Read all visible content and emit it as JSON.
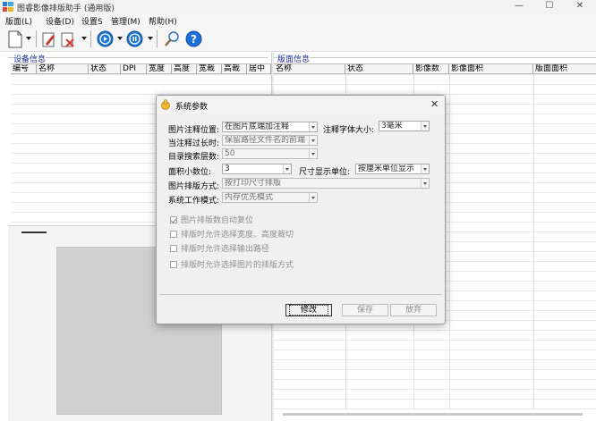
{
  "window": {
    "title": "图睿影像排版助手 (通用版)",
    "controls": {
      "minimize": "—",
      "maximize": "☐",
      "close": "✕"
    }
  },
  "menu": [
    "版面(L)",
    "设备(D)",
    "设置S",
    "管理(M)",
    "帮助(H)"
  ],
  "toolbar": {
    "icons": [
      "new-document-icon",
      "edit-icon",
      "delete-icon",
      "play-icon",
      "pause-icon",
      "search-icon",
      "help-icon"
    ]
  },
  "left_panel": {
    "group_label": "设备信息",
    "columns": [
      "编号",
      "名称",
      "状态",
      "DPI",
      "宽度",
      "高度",
      "宽裁",
      "高裁",
      "居中"
    ]
  },
  "right_panel": {
    "group_label": "版面信息",
    "columns": [
      "名称",
      "状态",
      "影像数",
      "影像面积",
      "版面面积"
    ]
  },
  "dialog": {
    "title": "系统参数",
    "close": "✕",
    "fields": {
      "annotation_position": {
        "label": "图片注释位置:",
        "value": "在图片底端加注释"
      },
      "annotation_font_size": {
        "label": "注释字体大小:",
        "value": "3毫米"
      },
      "long_annotation": {
        "label": "当注释过长时:",
        "value": "保留路径文件名的前端"
      },
      "dir_search_depth": {
        "label": "目录搜索层数:",
        "value": "50"
      },
      "area_decimals": {
        "label": "面积小数位:",
        "value": "3"
      },
      "size_unit": {
        "label": "尺寸显示单位:",
        "value": "按厘米单位显示"
      },
      "layout_method": {
        "label": "图片排版方式:",
        "value": "按打印尺寸排版"
      },
      "work_mode": {
        "label": "系统工作模式:",
        "value": "内存优先模式"
      }
    },
    "checkboxes": [
      {
        "label": "图片排版数自动复位",
        "checked": true
      },
      {
        "label": "排版时允许选择宽度、高度裁切",
        "checked": false
      },
      {
        "label": "排版时允许选择输出路径",
        "checked": false
      },
      {
        "label": "排版时允许选择图片的排版方式",
        "checked": false
      }
    ],
    "buttons": {
      "modify": "修改",
      "save": "保存",
      "discard": "放弃"
    }
  },
  "colors": {
    "group_label": "#1c2b8e",
    "help_blue": "#1e6fd9",
    "dialog_bg": "#f0f0f0"
  }
}
